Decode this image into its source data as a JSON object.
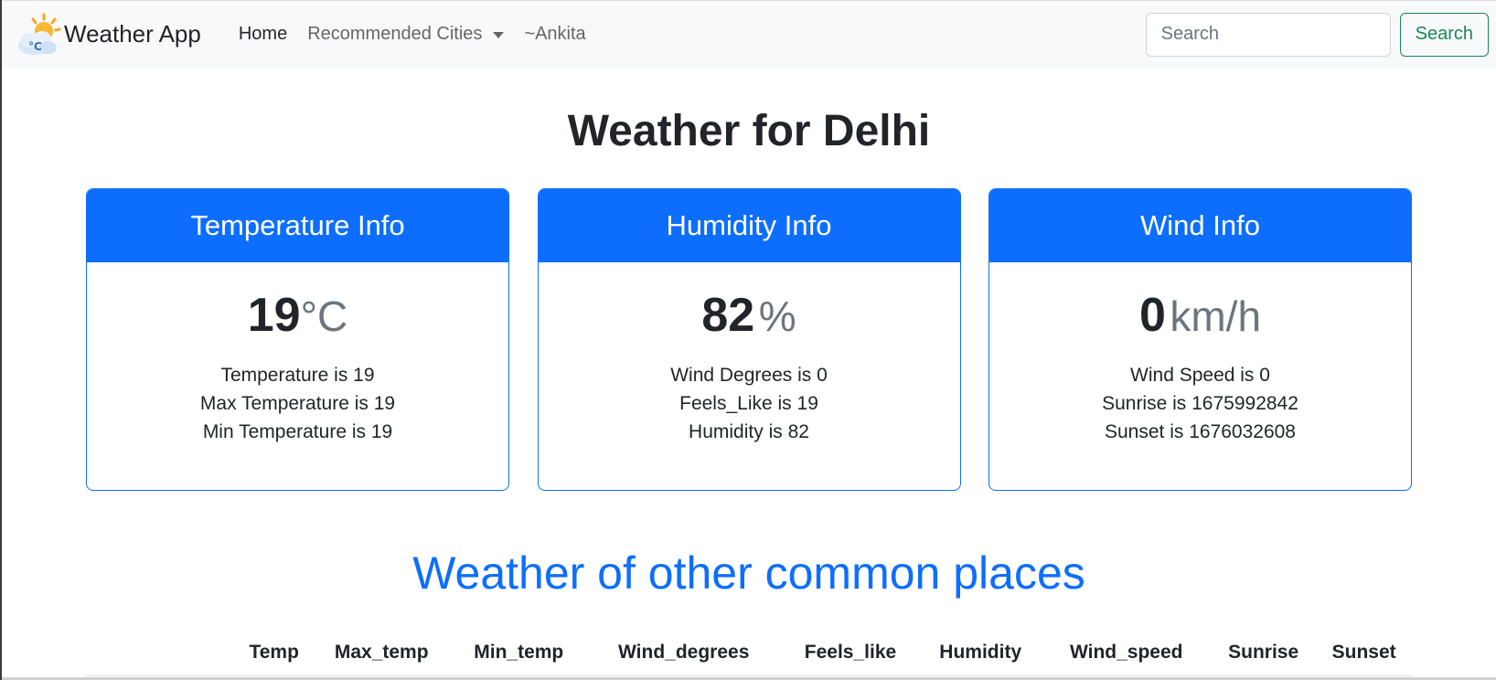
{
  "navbar": {
    "brand": "Weather App",
    "links": {
      "home": "Home",
      "recommended": "Recommended Cities",
      "user": "~Ankita"
    },
    "search": {
      "placeholder": "Search",
      "button_label": "Search"
    },
    "icons": {
      "logo": "weather-sun-cloud-icon",
      "dropdown": "caret-down-icon"
    }
  },
  "main": {
    "title": "Weather for Delhi",
    "cards": {
      "temperature": {
        "header": "Temperature Info",
        "value": "19",
        "unit": "°C",
        "lines": [
          "Temperature is 19",
          "Max Temperature is 19",
          "Min Temperature is 19"
        ]
      },
      "humidity": {
        "header": "Humidity Info",
        "value": "82",
        "unit": "%",
        "lines": [
          "Wind Degrees is 0",
          "Feels_Like is 19",
          "Humidity is 82"
        ]
      },
      "wind": {
        "header": "Wind Info",
        "value": "0",
        "unit": "km/h",
        "lines": [
          "Wind Speed is 0",
          "Sunrise is 1675992842",
          "Sunset is 1676032608"
        ]
      }
    },
    "section_title": "Weather of other common places",
    "table": {
      "headers": [
        "Temp",
        "Max_temp",
        "Min_temp",
        "Wind_degrees",
        "Feels_like",
        "Humidity",
        "Wind_speed",
        "Sunrise",
        "Sunset"
      ]
    }
  },
  "colors": {
    "primary": "#0d6efd",
    "success": "#198754",
    "navbar_bg": "#f8f9fa"
  }
}
